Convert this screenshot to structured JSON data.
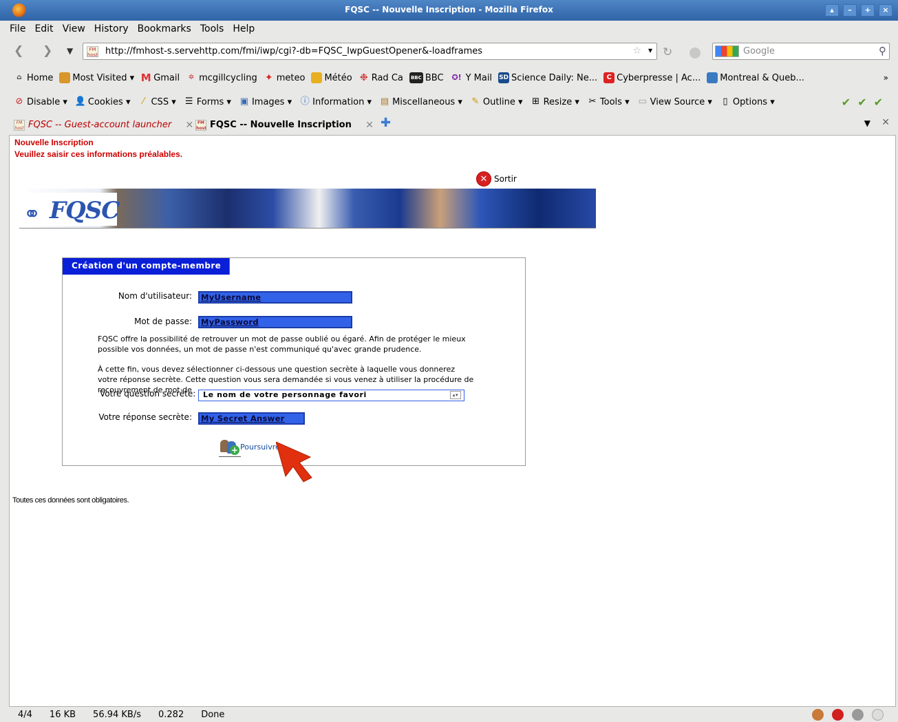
{
  "window": {
    "title": "FQSC -- Nouvelle Inscription - Mozilla Firefox"
  },
  "menubar": {
    "items": [
      "File",
      "Edit",
      "View",
      "History",
      "Bookmarks",
      "Tools",
      "Help"
    ]
  },
  "navbar": {
    "url": "http://fmhost-s.servehttp.com/fmi/iwp/cgi?-db=FQSC_IwpGuestOpener&-loadframes",
    "search_placeholder": "Google"
  },
  "bookmarks": {
    "items": [
      {
        "label": "Home",
        "icon": "home-icon"
      },
      {
        "label": "Most Visited",
        "icon": "folder-icon"
      },
      {
        "label": "Gmail",
        "icon": "gmail-icon"
      },
      {
        "label": "mcgillcycling",
        "icon": "site-icon"
      },
      {
        "label": "meteo",
        "icon": "maple-leaf-icon"
      },
      {
        "label": "Météo",
        "icon": "weather-icon"
      },
      {
        "label": "Rad Ca",
        "icon": "radio-canada-icon"
      },
      {
        "label": "BBC",
        "icon": "bbc-icon"
      },
      {
        "label": "Y Mail",
        "icon": "yahoo-icon"
      },
      {
        "label": "Science Daily: Ne...",
        "icon": "science-daily-icon"
      },
      {
        "label": "Cyberpresse | Ac...",
        "icon": "cyberpresse-icon"
      },
      {
        "label": "Montreal & Queb...",
        "icon": "montreal-icon"
      }
    ],
    "more": "»"
  },
  "webdev": {
    "items": [
      "Disable",
      "Cookies",
      "CSS",
      "Forms",
      "Images",
      "Information",
      "Miscellaneous",
      "Outline",
      "Resize",
      "Tools",
      "View Source",
      "Options"
    ]
  },
  "tabs": [
    {
      "label": "FQSC -- Guest-account launcher"
    },
    {
      "label": "FQSC -- Nouvelle Inscription"
    }
  ],
  "page": {
    "heading1": "Nouvelle Inscription",
    "heading2": "Veuillez saisir ces informations préalables.",
    "sortir": "Sortir",
    "logo_text": "FQSC",
    "form_title": "Création d'un compte-membre",
    "username_label": "Nom d'utilisateur:",
    "username_value": "MyUsername",
    "password_label": "Mot de passe:",
    "password_value": "MyPassword",
    "para1": "FQSC offre la possibilité de retrouver un mot de passe oublié ou égaré. Afin de protéger le mieux possible vos données, un mot de passe n'est communiqué qu'avec grande prudence.",
    "para2": "À cette fin, vous devez sélectionner ci-dessous une question secrète à laquelle vous donnerez votre réponse secrète. Cette question vous sera demandée si vous venez à utiliser la procédure de recouvrement de mot de",
    "question_label": "Votre question secrète:",
    "question_value": "Le nom de votre personnage favori",
    "answer_label": "Votre réponse secrète:",
    "answer_value": "My Secret Answer",
    "submit_label": "Poursuivre",
    "footnote": "Toutes ces données sont obligatoires."
  },
  "statusbar": {
    "page_count": "4/4",
    "size": "16 KB",
    "speed": "56.94 KB/s",
    "time": "0.282",
    "status": "Done"
  },
  "colors": {
    "titlebar": "#2f64a8",
    "form_title_bg": "#0a1fd8",
    "field_bg": "#3262e8",
    "heading_red": "#cc0000"
  }
}
